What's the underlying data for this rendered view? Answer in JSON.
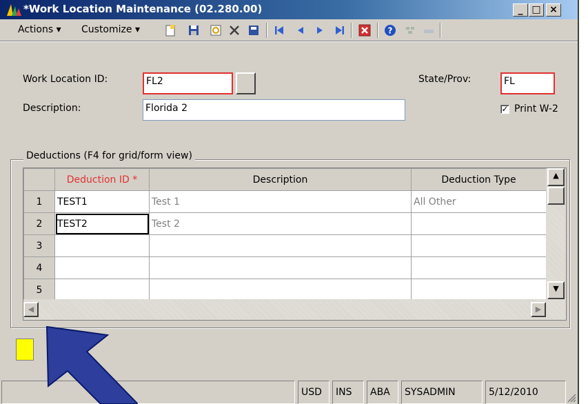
{
  "window": {
    "title": "*Work Location Maintenance (02.280.00)",
    "minimize": "_",
    "maximize": "□",
    "close": "×"
  },
  "menu": {
    "actions": "Actions",
    "customize": "Customize"
  },
  "form": {
    "work_location_id_label": "Work Location ID:",
    "work_location_id_value": "FL2",
    "description_label": "Description:",
    "description_value": "Florida 2",
    "state_label": "State/Prov:",
    "state_value": "FL",
    "print_w2_label": "Print W-2",
    "print_w2_checked": "✓"
  },
  "deductions": {
    "group_title": "Deductions (F4 for grid/form view)",
    "columns": [
      "Deduction ID *",
      "Description",
      "Deduction Type"
    ],
    "rows": [
      {
        "num": "1",
        "id": "TEST1",
        "description": "Test 1",
        "type": "All Other"
      },
      {
        "num": "2",
        "id": "TEST2",
        "description": "Test 2",
        "type": ""
      },
      {
        "num": "3",
        "id": "",
        "description": "",
        "type": ""
      },
      {
        "num": "4",
        "id": "",
        "description": "",
        "type": ""
      },
      {
        "num": "5",
        "id": "",
        "description": "",
        "type": ""
      }
    ]
  },
  "status": {
    "currency": "USD",
    "mode": "INS",
    "company": "ABA",
    "user": "SYSADMIN",
    "date": "5/12/2010"
  },
  "colors": {
    "title_gradient_start": "#0a246a",
    "required_border": "#e03030",
    "note_indicator": "#ffff00",
    "arrow": "#2e3e9c"
  }
}
